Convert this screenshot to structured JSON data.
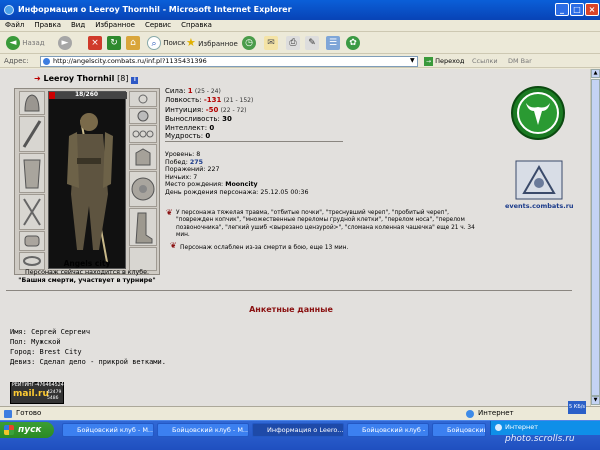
{
  "window": {
    "title": "Информация о Leeroy Thornhil - Microsoft Internet Explorer"
  },
  "menu": [
    "Файл",
    "Правка",
    "Вид",
    "Избранное",
    "Сервис",
    "Справка"
  ],
  "toolbar": {
    "back": "Назад",
    "search": "Поиск",
    "favorites": "Избранное"
  },
  "address": {
    "label": "Адрес:",
    "url": "http://angelscity.combats.ru/inf.pl?1135431396",
    "go": "Переход",
    "links": "Ссылки",
    "dm": "DM Bar"
  },
  "character": {
    "name": "Leeroy Thornhil",
    "level": "[8]",
    "hp": "18/260",
    "location": "Angels city",
    "status_line": "Персонаж сейчас находится в клубе.",
    "room": "\"Башня смерти, участвует в турнире\""
  },
  "stats": [
    {
      "label": "Сила:",
      "value": "1",
      "range": "(25 - 24)"
    },
    {
      "label": "Ловкость:",
      "value": "-131",
      "range": "(21 - 152)"
    },
    {
      "label": "Интуиция:",
      "value": "-50",
      "range": "(22 - 72)"
    },
    {
      "label": "Выносливость:",
      "value": "30",
      "range": ""
    },
    {
      "label": "Интеллект:",
      "value": "0",
      "range": ""
    },
    {
      "label": "Мудрость:",
      "value": "0",
      "range": ""
    }
  ],
  "info": [
    {
      "label": "Уровень:",
      "value": "8"
    },
    {
      "label": "Побед:",
      "value": "275"
    },
    {
      "label": "Поражений:",
      "value": "227"
    },
    {
      "label": "Ничьих:",
      "value": "7"
    },
    {
      "label": "Место рождения:",
      "value": "Mooncity"
    },
    {
      "label": "День рождения персонажа:",
      "value": "25.12.05 00:36"
    }
  ],
  "trauma": "У персонажа тяжелая травма, \"отбитые почки\", \"треснувший череп\", \"пробитый череп\", \"поврежден копчик\", \"множественные переломы грудной клетки\", \"перелом носа\", \"перелом позвоночника\", \"легкий ушиб <вырезано цензурой>\", \"сломана коленная чашечка\" еще 21 ч. 34 мин.",
  "weakened": "Персонаж ослаблен из-за смерти в бою, еще 13 мин.",
  "events_link": "events.combats.ru",
  "profile": {
    "heading": "Анкетные данные",
    "name": "Имя: Сергей Сергеич",
    "sex": "Пол: Мужской",
    "city": "Город: Brest City",
    "motto": "Девиз: Сделал дело - прикрой ветками."
  },
  "counter": {
    "rating": "РЕЙТИНГ",
    "value": "476464524",
    "site": "mail.ru",
    "n1": "42479",
    "n2": "5486"
  },
  "status": {
    "text": "Готово",
    "zone": "Интернет",
    "speed": "5 КБ/s"
  },
  "taskbar": {
    "start": "пуск",
    "tasks": [
      "Бойцовский клуб - M...",
      "Бойцовский клуб - M...",
      "Информация о Leero...",
      "Бойцовский клуб - M...",
      "Бойцовский клуб - M..."
    ],
    "zone": "Интернет"
  },
  "watermark": "photo.scrolls.ru"
}
